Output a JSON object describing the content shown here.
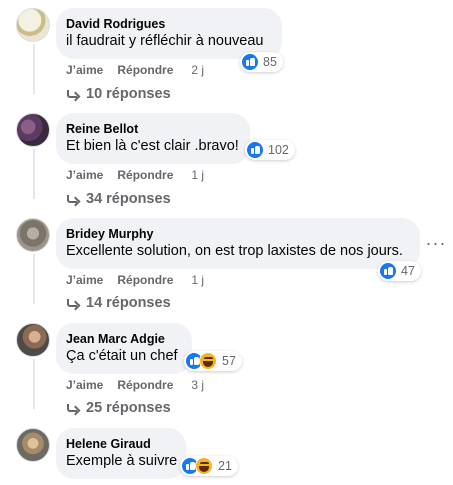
{
  "comments": [
    {
      "author": "David Rodrigues",
      "text": "il faudrait y réfléchir à nouveau",
      "reaction_count": "85",
      "reactions": [
        "like"
      ],
      "like_label": "J’aime",
      "reply_label": "Répondre",
      "time": "2 j",
      "replies": "10 réponses"
    },
    {
      "author": "Reine Bellot",
      "text": "Et bien là c'est clair .bravo!",
      "reaction_count": "102",
      "reactions": [
        "like"
      ],
      "like_label": "J’aime",
      "reply_label": "Répondre",
      "time": "1 j",
      "replies": "34 réponses"
    },
    {
      "author": "Bridey Murphy",
      "text": "Excellente solution, on est trop laxistes de nos jours.",
      "reaction_count": "47",
      "reactions": [
        "like"
      ],
      "like_label": "J’aime",
      "reply_label": "Répondre",
      "time": "1 j",
      "replies": "14 réponses",
      "more": "···"
    },
    {
      "author": "Jean Marc Adgie",
      "text": "Ça c'était un chef",
      "reaction_count": "57",
      "reactions": [
        "like",
        "haha"
      ],
      "like_label": "J’aime",
      "reply_label": "Répondre",
      "time": "3 j",
      "replies": "25 réponses"
    },
    {
      "author": "Helene Giraud",
      "text": "Exemple à suivre",
      "reaction_count": "21",
      "reactions": [
        "like",
        "haha"
      ]
    }
  ],
  "colors": {
    "bubble": "#f0f2f5",
    "like_blue": "#1877f2",
    "haha_yellow": "#f7b125",
    "secondary_text": "#65676b"
  }
}
